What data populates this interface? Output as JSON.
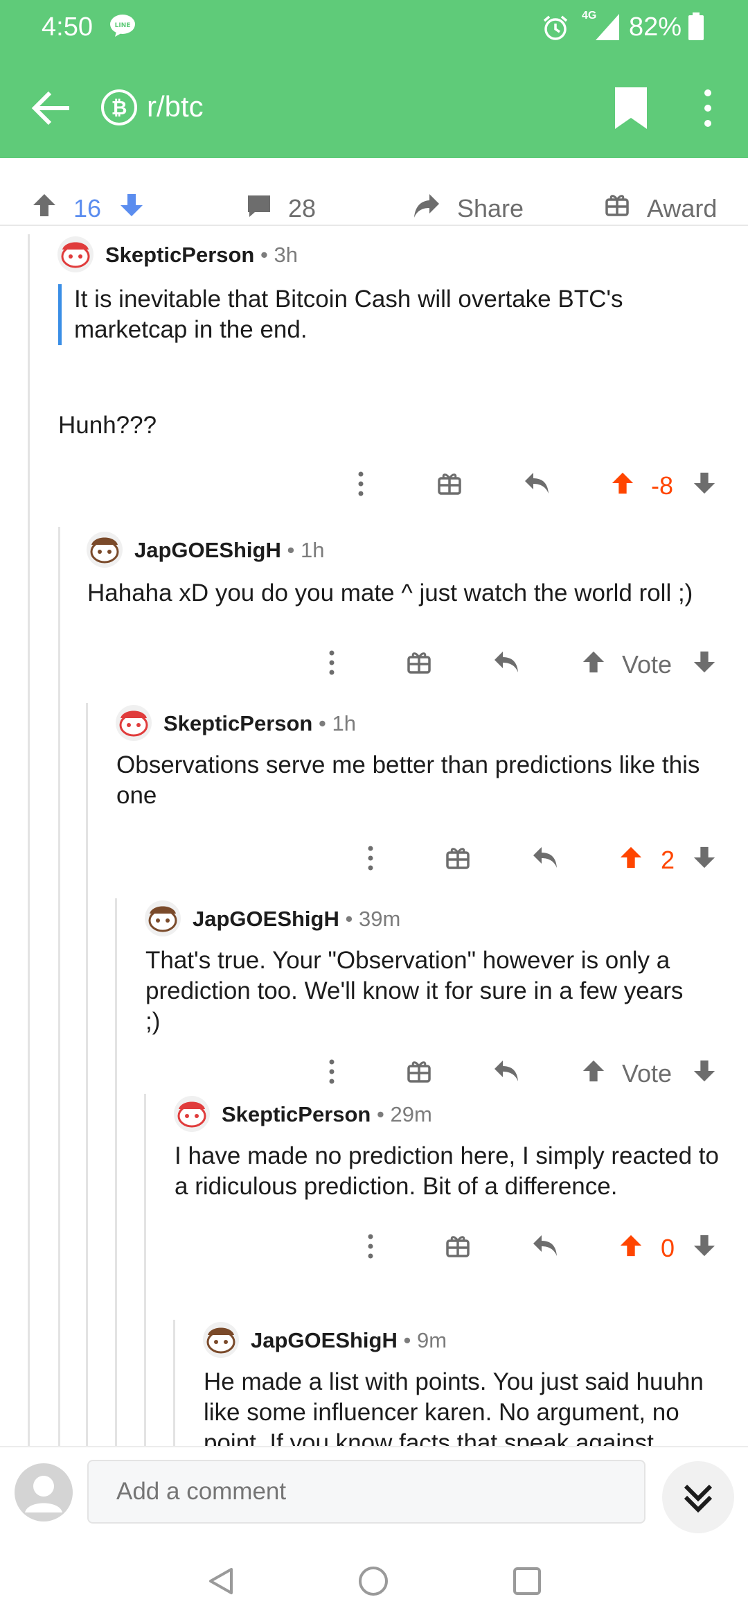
{
  "status_bar": {
    "time": "4:50",
    "network": "4G",
    "battery": "82%",
    "line_badge": "LINE"
  },
  "app_bar": {
    "subreddit": "r/btc"
  },
  "post_actions": {
    "score": "16",
    "comments": "28",
    "share": "Share",
    "award": "Award"
  },
  "comments": [
    {
      "author": "SkepticPerson",
      "age": "3h",
      "quote": "It is inevitable that Bitcoin Cash will overtake BTC's marketcap in the end.",
      "text": "Hunh???",
      "score": "-8"
    },
    {
      "author": "JapGOEShigH",
      "age": "1h",
      "text": "Hahaha xD you do you mate ^ just watch the world roll ;)",
      "score": "Vote"
    },
    {
      "author": "SkepticPerson",
      "age": "1h",
      "text": "Observations serve me better than predictions like this one",
      "score": "2"
    },
    {
      "author": "JapGOEShigH",
      "age": "39m",
      "text": "That's true. Your \"Observation\" however is only a prediction too. We'll know it for sure in a few years ;)",
      "score": "Vote"
    },
    {
      "author": "SkepticPerson",
      "age": "29m",
      "text": "I have made no prediction here, I simply reacted to a ridiculous prediction. Bit of a difference.",
      "score": "0"
    },
    {
      "author": "JapGOEShigH",
      "age": "9m",
      "text": "He made a list with points. You just said huuhn like some influencer karen. No argument, no point. If you know facts that speak against"
    }
  ],
  "comment_bar": {
    "placeholder": "Add a comment"
  },
  "colors": {
    "header_green": "#5fcb79",
    "upvote_orange": "#ff4500",
    "score_blue": "#5b8def",
    "quote_blue": "#3a8ee6"
  }
}
